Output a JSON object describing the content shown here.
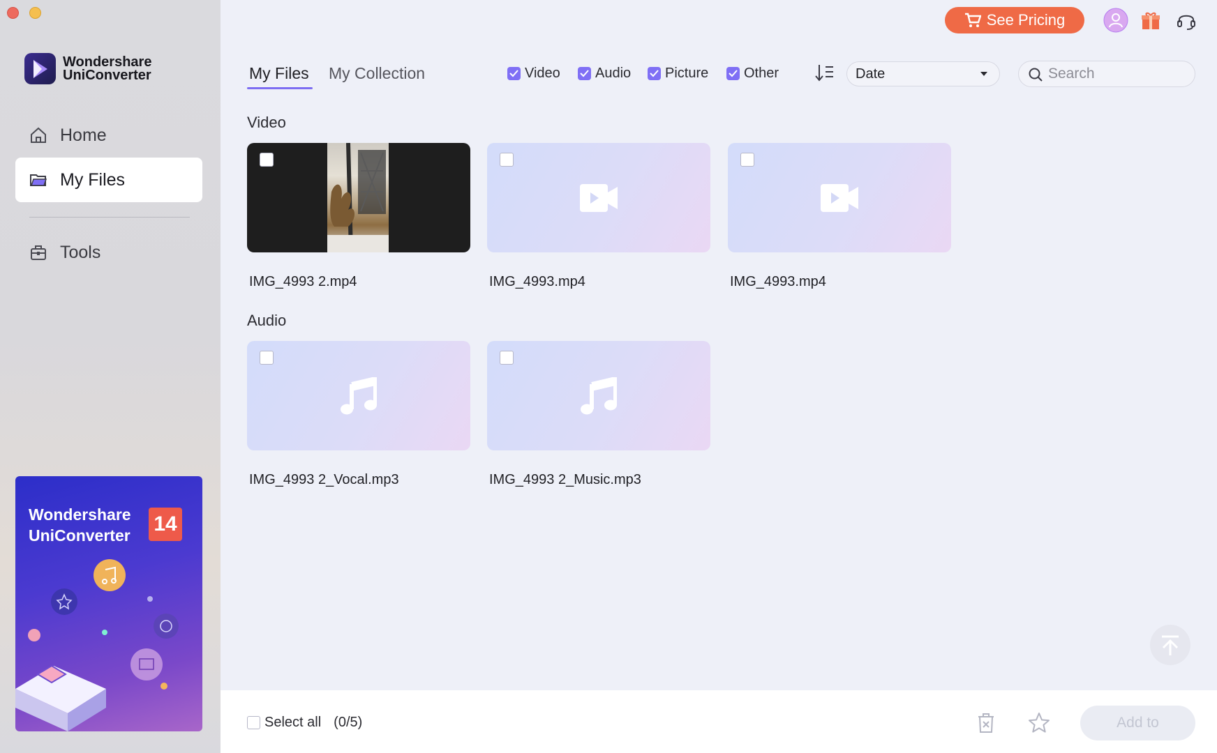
{
  "window": {
    "controls": [
      "close",
      "minimize"
    ]
  },
  "brand": {
    "line1": "Wondershare",
    "line2": "UniConverter"
  },
  "sidebar": {
    "items": [
      {
        "label": "Home",
        "icon": "home-icon"
      },
      {
        "label": "My Files",
        "icon": "folder-icon",
        "active": true
      },
      {
        "label": "Tools",
        "icon": "toolbox-icon"
      }
    ]
  },
  "promo": {
    "title_line1": "Wondershare",
    "title_line2": "UniConverter",
    "version": "14"
  },
  "topbar": {
    "pricing_label": "See Pricing"
  },
  "tabs": [
    {
      "label": "My Files",
      "active": true
    },
    {
      "label": "My Collection",
      "active": false
    }
  ],
  "filters": [
    {
      "label": "Video",
      "checked": true
    },
    {
      "label": "Audio",
      "checked": true
    },
    {
      "label": "Picture",
      "checked": true
    },
    {
      "label": "Other",
      "checked": true
    }
  ],
  "sort": {
    "selected": "Date"
  },
  "search": {
    "placeholder": "Search"
  },
  "sections": {
    "video": {
      "title": "Video",
      "files": [
        {
          "name": "IMG_4993 2.mp4",
          "thumb": "photo"
        },
        {
          "name": "IMG_4993.mp4",
          "thumb": "video-placeholder"
        },
        {
          "name": "IMG_4993.mp4",
          "thumb": "video-placeholder"
        }
      ]
    },
    "audio": {
      "title": "Audio",
      "files": [
        {
          "name": "IMG_4993 2_Vocal.mp3",
          "thumb": "music-placeholder"
        },
        {
          "name": "IMG_4993 2_Music.mp3",
          "thumb": "music-placeholder"
        }
      ]
    }
  },
  "footer": {
    "select_all_label": "Select all",
    "count": "(0/5)",
    "add_label": "Add to"
  },
  "colors": {
    "accent": "#7f6ff5",
    "pricing": "#ef6a46",
    "background": "#eef0f8"
  }
}
